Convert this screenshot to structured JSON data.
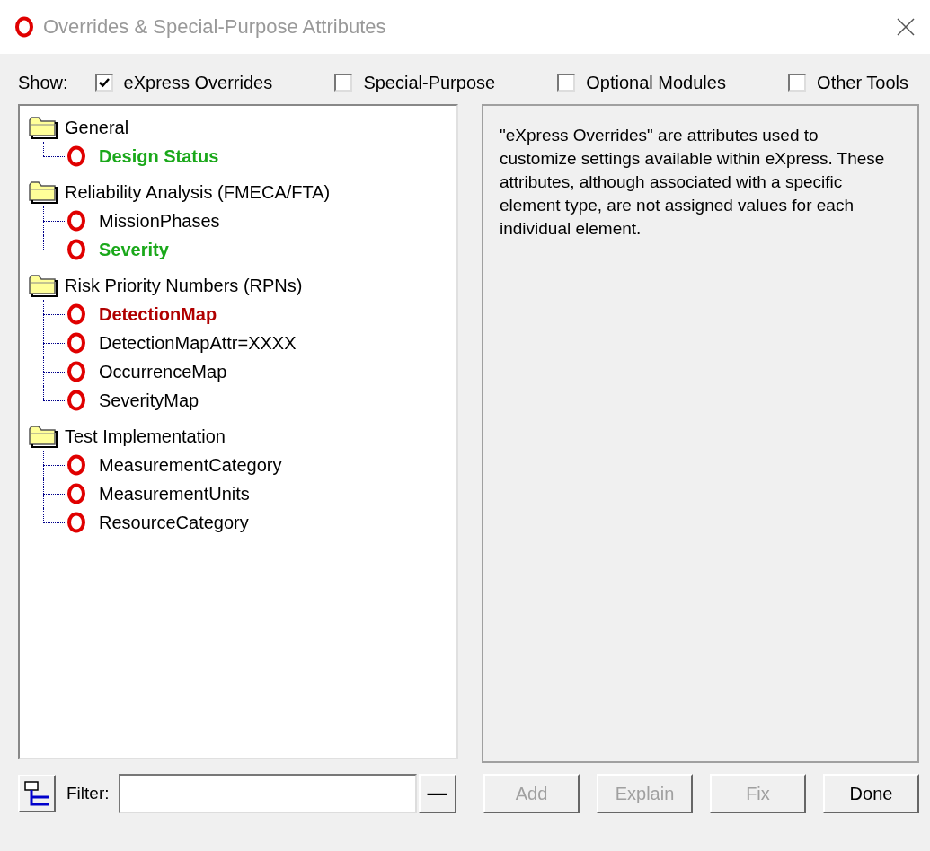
{
  "window": {
    "title": "Overrides & Special-Purpose Attributes"
  },
  "show": {
    "label": "Show:",
    "options": [
      {
        "label": "eXpress Overrides",
        "checked": true
      },
      {
        "label": "Special-Purpose",
        "checked": false
      },
      {
        "label": "Optional Modules",
        "checked": false
      },
      {
        "label": "Other Tools",
        "checked": false
      }
    ]
  },
  "tree": [
    {
      "label": "General",
      "children": [
        {
          "label": "Design Status",
          "color": "#1aa81a",
          "bold": true
        }
      ]
    },
    {
      "label": "Reliability Analysis (FMECA/FTA)",
      "children": [
        {
          "label": "MissionPhases",
          "color": "#000000",
          "bold": false
        },
        {
          "label": "Severity",
          "color": "#1aa81a",
          "bold": true
        }
      ]
    },
    {
      "label": "Risk Priority Numbers (RPNs)",
      "children": [
        {
          "label": "DetectionMap",
          "color": "#b00000",
          "bold": true
        },
        {
          "label": "DetectionMapAttr=XXXX",
          "color": "#000000",
          "bold": false
        },
        {
          "label": "OccurrenceMap",
          "color": "#000000",
          "bold": false
        },
        {
          "label": "SeverityMap",
          "color": "#000000",
          "bold": false
        }
      ]
    },
    {
      "label": "Test Implementation",
      "children": [
        {
          "label": "MeasurementCategory",
          "color": "#000000",
          "bold": false
        },
        {
          "label": "MeasurementUnits",
          "color": "#000000",
          "bold": false
        },
        {
          "label": "ResourceCategory",
          "color": "#000000",
          "bold": false
        }
      ]
    }
  ],
  "description": "\"eXpress Overrides\" are attributes used to customize settings available within eXpress. These attributes, although associated with a specific element type, are not assigned values for each individual element.",
  "filter": {
    "label": "Filter:",
    "clear": "—"
  },
  "buttons": [
    {
      "label": "Add",
      "disabled": true
    },
    {
      "label": "Explain",
      "disabled": true
    },
    {
      "label": "Fix",
      "disabled": true
    },
    {
      "label": "Done",
      "disabled": false
    }
  ]
}
